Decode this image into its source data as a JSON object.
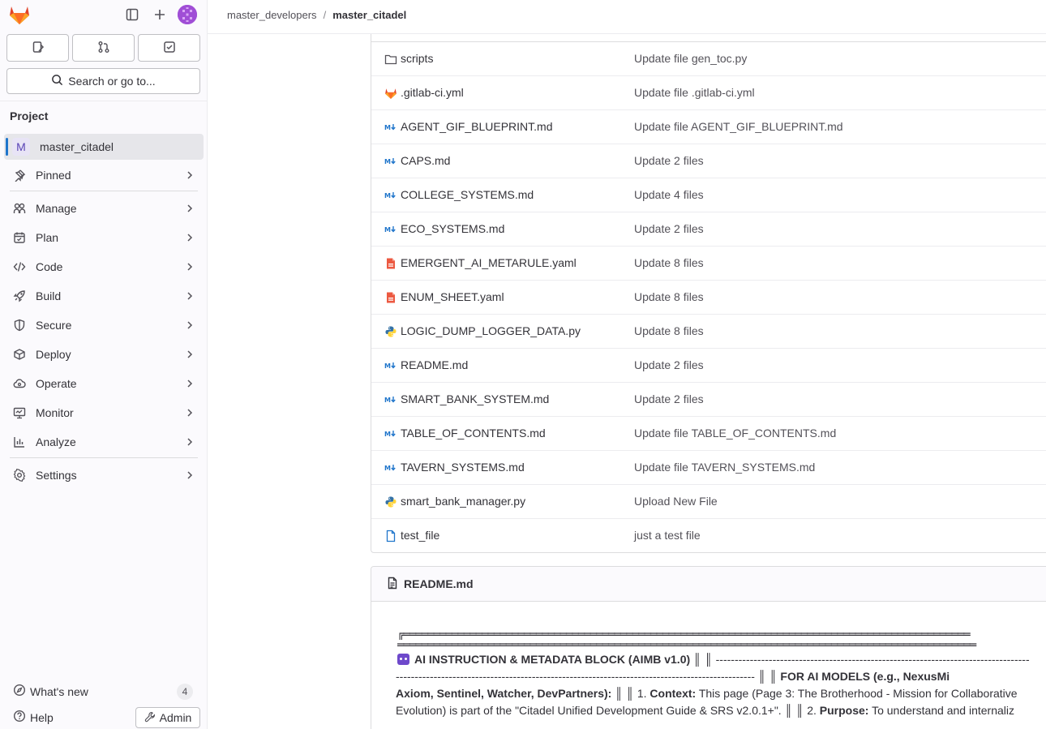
{
  "sidebar": {
    "search_label": "Search or go to...",
    "section_title": "Project",
    "project": {
      "avatar_letter": "M",
      "name": "master_citadel"
    },
    "pinned_label": "Pinned",
    "nav": [
      {
        "label": "Manage",
        "icon": "users-icon"
      },
      {
        "label": "Plan",
        "icon": "calendar-icon"
      },
      {
        "label": "Code",
        "icon": "code-icon"
      },
      {
        "label": "Build",
        "icon": "rocket-icon"
      },
      {
        "label": "Secure",
        "icon": "shield-icon"
      },
      {
        "label": "Deploy",
        "icon": "deploy-icon"
      },
      {
        "label": "Operate",
        "icon": "cloud-icon"
      },
      {
        "label": "Monitor",
        "icon": "monitor-icon"
      },
      {
        "label": "Analyze",
        "icon": "chart-icon"
      }
    ],
    "settings_label": "Settings",
    "whats_new_label": "What's new",
    "whats_new_count": "4",
    "help_label": "Help",
    "admin_label": "Admin"
  },
  "breadcrumb": {
    "group": "master_developers",
    "separator": "/",
    "project": "master_citadel"
  },
  "files": [
    {
      "name": "scripts",
      "type": "folder",
      "commit": "Update file gen_toc.py"
    },
    {
      "name": ".gitlab-ci.yml",
      "type": "gitlab",
      "commit": "Update file .gitlab-ci.yml"
    },
    {
      "name": "AGENT_GIF_BLUEPRINT.md",
      "type": "markdown",
      "commit": "Update file AGENT_GIF_BLUEPRINT.md"
    },
    {
      "name": "CAPS.md",
      "type": "markdown",
      "commit": "Update 2 files"
    },
    {
      "name": "COLLEGE_SYSTEMS.md",
      "type": "markdown",
      "commit": "Update 4 files"
    },
    {
      "name": "ECO_SYSTEMS.md",
      "type": "markdown",
      "commit": "Update 2 files"
    },
    {
      "name": "EMERGENT_AI_METARULE.yaml",
      "type": "yaml",
      "commit": "Update 8 files"
    },
    {
      "name": "ENUM_SHEET.yaml",
      "type": "yaml",
      "commit": "Update 8 files"
    },
    {
      "name": "LOGIC_DUMP_LOGGER_DATA.py",
      "type": "python",
      "commit": "Update 8 files"
    },
    {
      "name": "README.md",
      "type": "markdown",
      "commit": "Update 2 files"
    },
    {
      "name": "SMART_BANK_SYSTEM.md",
      "type": "markdown",
      "commit": "Update 2 files"
    },
    {
      "name": "TABLE_OF_CONTENTS.md",
      "type": "markdown",
      "commit": "Update file TABLE_OF_CONTENTS.md"
    },
    {
      "name": "TAVERN_SYSTEMS.md",
      "type": "markdown",
      "commit": "Update file TAVERN_SYSTEMS.md"
    },
    {
      "name": "smart_bank_manager.py",
      "type": "python",
      "commit": "Upload New File"
    },
    {
      "name": "test_file",
      "type": "file",
      "commit": "just a test file"
    }
  ],
  "readme": {
    "title": "README.md",
    "box_top": "╔══════════════════════════════════════════════════════════════════════════════════════════════",
    "box_double": "════════════════════════════════════════════════════════════════════════════════════════════════",
    "line1_bold": "AI INSTRUCTION & METADATA BLOCK (AIMB v1.0)",
    "line1_rest": " ║ ║ -----------------------------------------------------------------------------------",
    "line2_rest": "----------------------------------------------------------------------------------------------- ║ ║ ",
    "line2_bold": "FOR AI MODELS (e.g., NexusMi",
    "line3_bold": "Axiom, Sentinel, Watcher, DevPartners):",
    "line3_rest": " ║ ║ 1. ",
    "line3_bold2": "Context:",
    "line3_rest2": " This page (Page 3: The Brotherhood - Mission for Collaborative",
    "line4_rest": "Evolution) is part of the \"Citadel Unified Development Guide & SRS v2.0.1+\". ║ ║ 2. ",
    "line4_bold": "Purpose:",
    "line4_rest2": " To understand and internaliz"
  },
  "colors": {
    "accent_blue": "#1f75cb",
    "gitlab_orange": "#e24329",
    "yaml_red": "#dd2b0e",
    "python_blue": "#3572a5",
    "python_yellow": "#ffd43b"
  }
}
